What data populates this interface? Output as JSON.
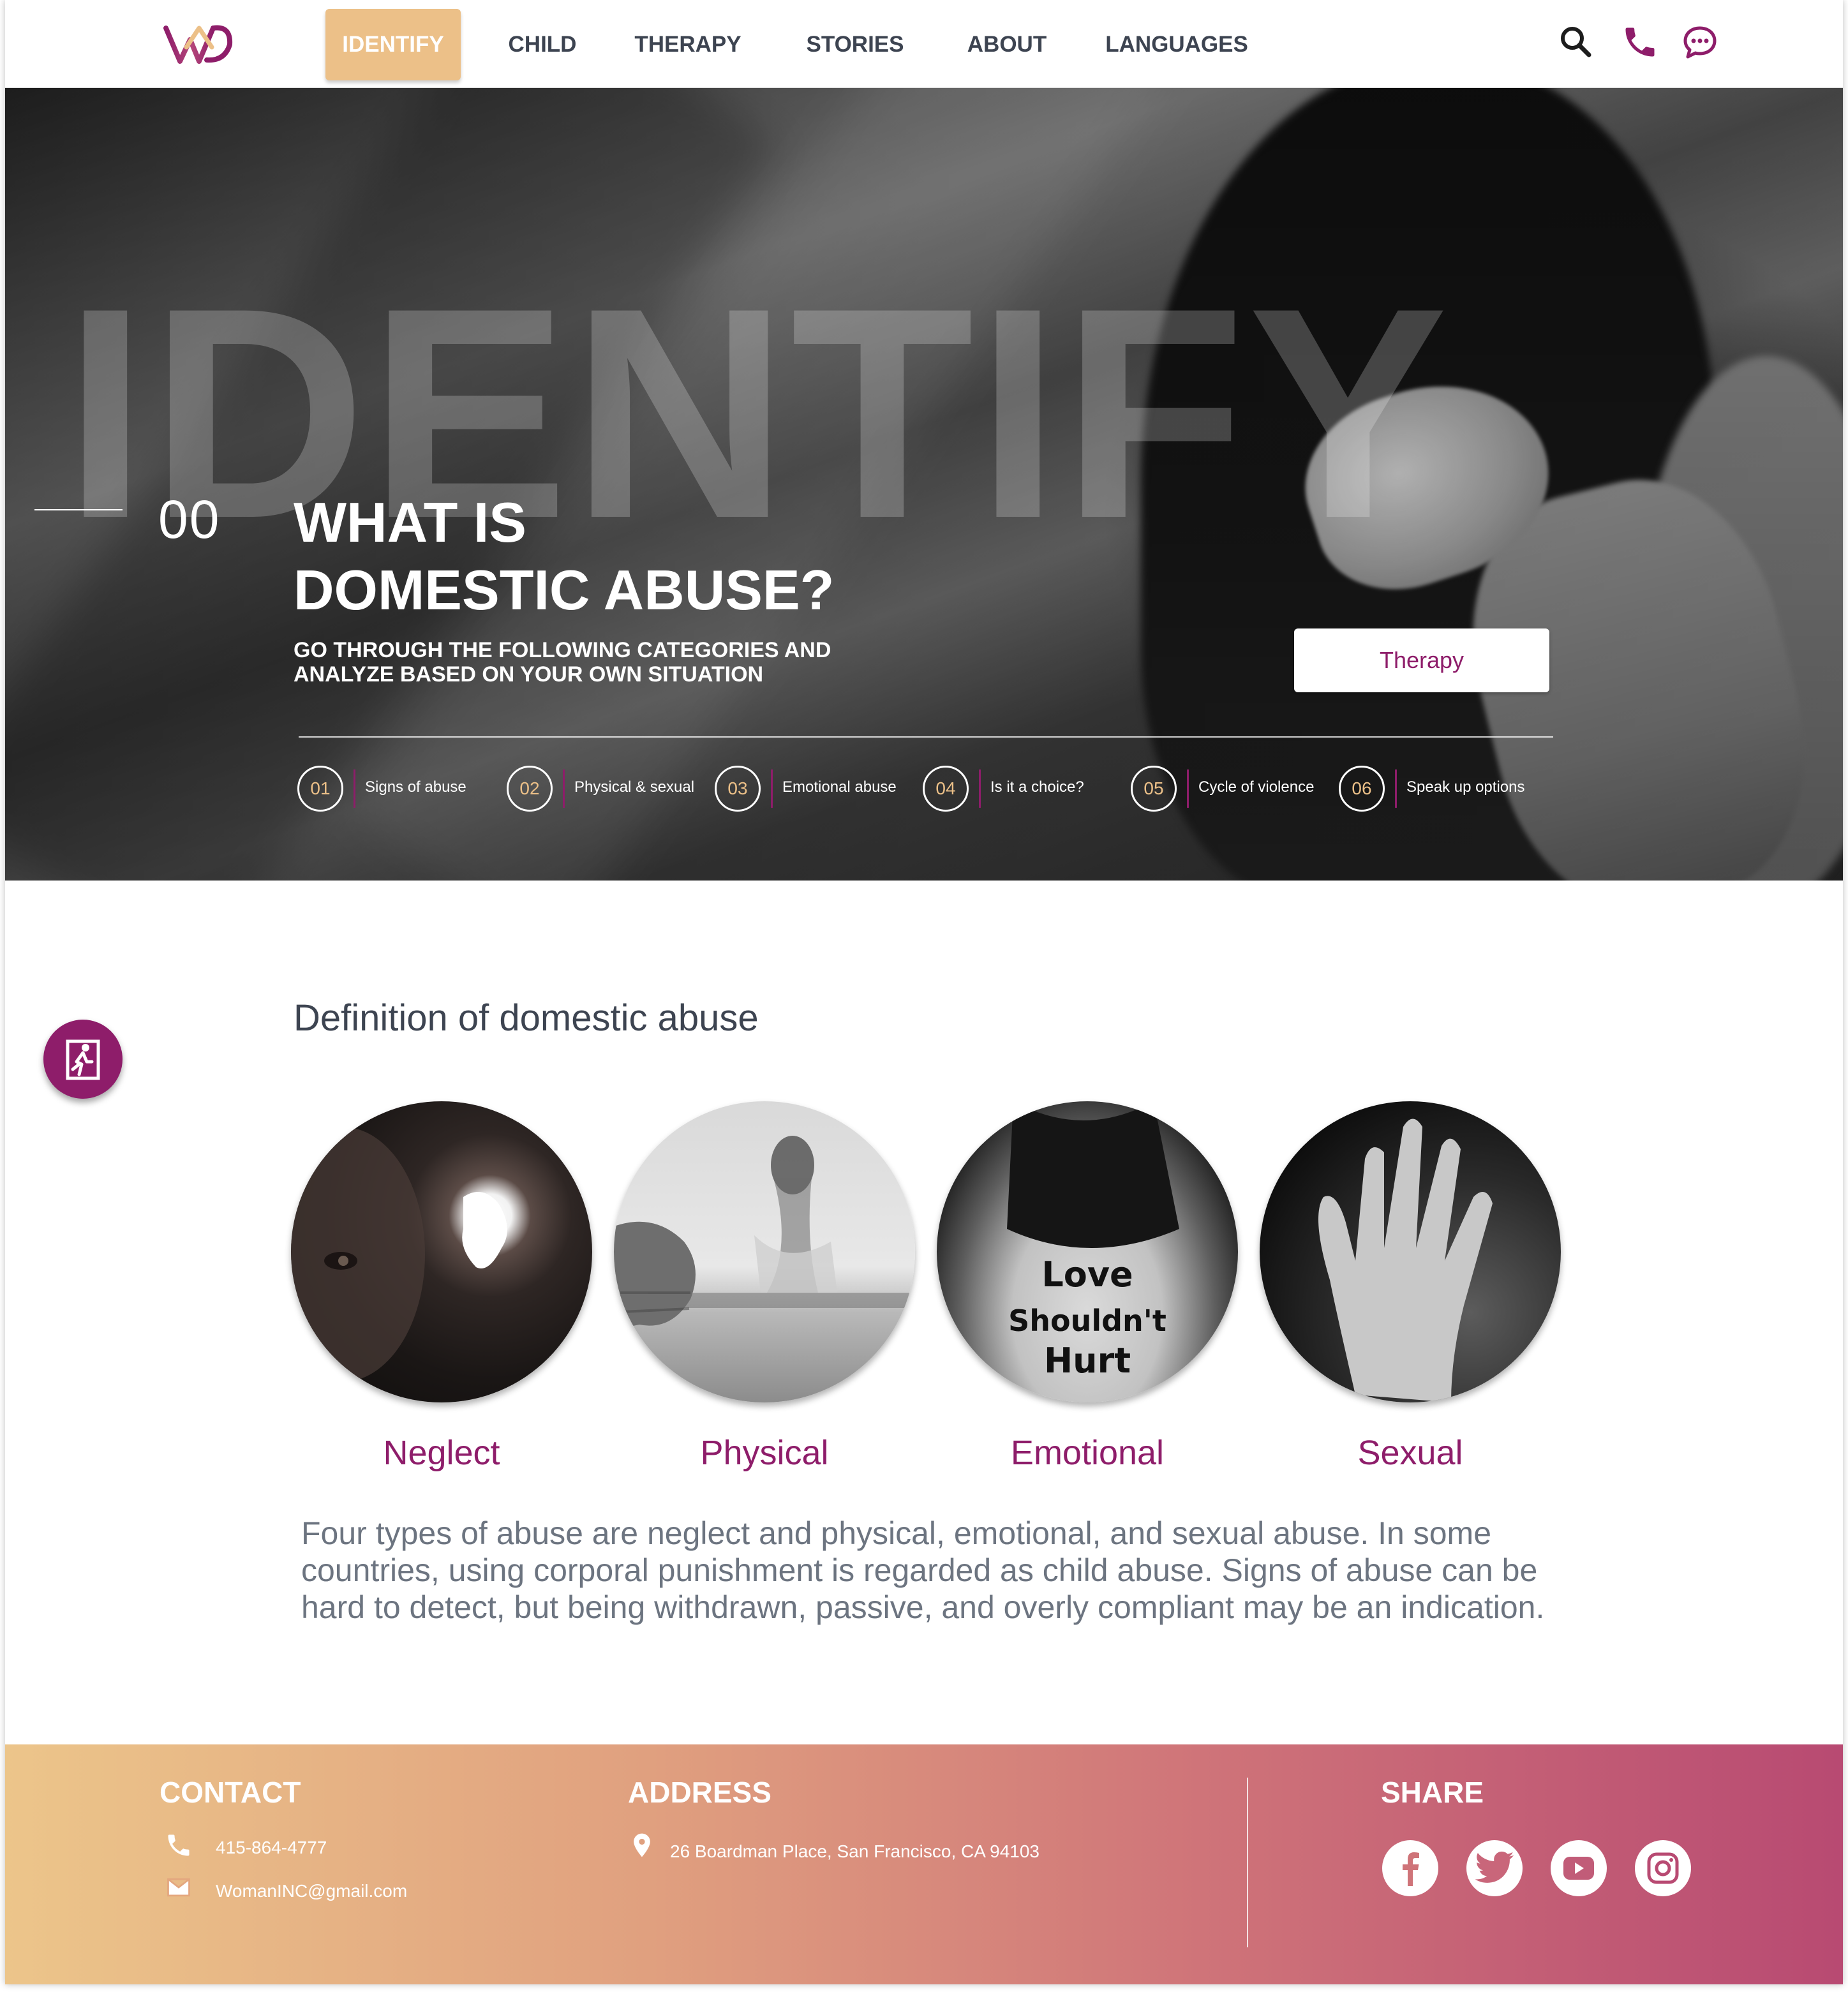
{
  "nav": {
    "items": [
      {
        "label": "IDENTIFY",
        "active": true
      },
      {
        "label": "CHILD",
        "active": false
      },
      {
        "label": "THERAPY",
        "active": false
      },
      {
        "label": "STORIES",
        "active": false
      },
      {
        "label": "ABOUT",
        "active": false
      },
      {
        "label": "LANGUAGES",
        "active": false
      }
    ],
    "icons": [
      "search-icon",
      "phone-icon",
      "chat-icon"
    ]
  },
  "hero": {
    "watermark": "IDENTIFY",
    "number": "00",
    "title_line1": "WHAT IS",
    "title_line2": "DOMESTIC ABUSE?",
    "subtitle_line1": "GO THROUGH THE FOLLOWING CATEGORIES AND",
    "subtitle_line2": "ANALYZE BASED ON YOUR OWN SITUATION",
    "button_label": "Therapy",
    "steps": [
      {
        "num": "01",
        "label": "Signs of abuse"
      },
      {
        "num": "02",
        "label": "Physical & sexual"
      },
      {
        "num": "03",
        "label": "Emotional abuse"
      },
      {
        "num": "04",
        "label": "Is it a choice?"
      },
      {
        "num": "05",
        "label": "Cycle of violence"
      },
      {
        "num": "06",
        "label": "Speak up options"
      }
    ]
  },
  "main": {
    "title": "Definition of domestic abuse",
    "exit_icon": "emergency-exit-icon",
    "types": [
      {
        "label": "Neglect"
      },
      {
        "label": "Physical"
      },
      {
        "label": "Emotional",
        "image_text": [
          "Love",
          "Shouldn't",
          "Hurt"
        ]
      },
      {
        "label": "Sexual"
      }
    ],
    "body": "Four types of abuse are neglect and physical, emotional, and sexual abuse. In some countries, using corporal punishment is regarded as child abuse. Signs of abuse can be hard to detect, but being withdrawn, passive, and overly compliant may be an indication."
  },
  "footer": {
    "contact_heading": "CONTACT",
    "phone": "415-864-4777",
    "email": "WomanINC@gmail.com",
    "address_heading": "ADDRESS",
    "address": "26 Boardman Place, San Francisco, CA 94103",
    "share_heading": "SHARE",
    "social": [
      "facebook-icon",
      "twitter-icon",
      "youtube-icon",
      "instagram-icon"
    ]
  },
  "colors": {
    "brand": "#8e1d6a",
    "accent": "#ecc088",
    "text_dark": "#3d4451",
    "text_muted": "#6c7480"
  }
}
